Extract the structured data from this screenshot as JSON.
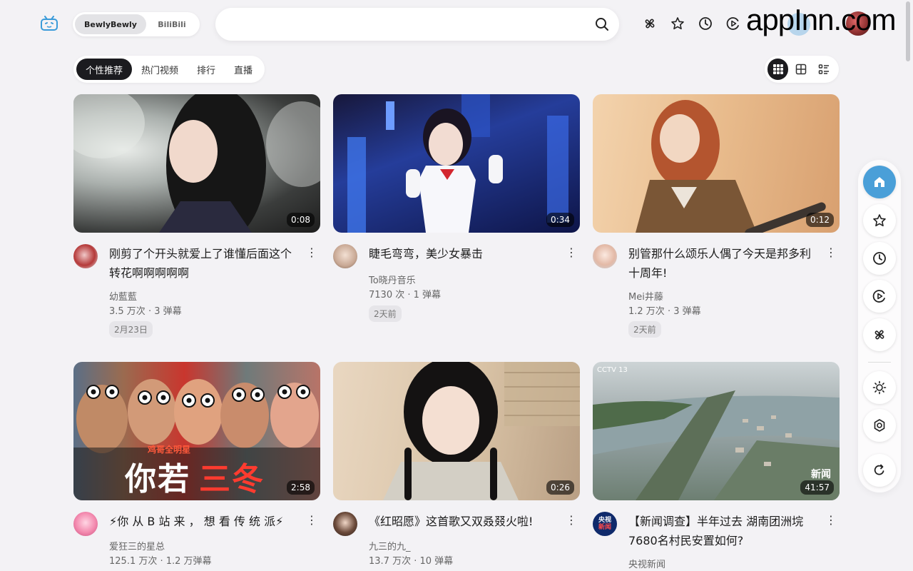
{
  "header": {
    "switch": {
      "active": "BewlyBewly",
      "other": "BiliBili"
    },
    "search": {
      "placeholder": ""
    },
    "watermark": "appInn.com"
  },
  "tabs": [
    "个性推荐",
    "热门视频",
    "排行",
    "直播"
  ],
  "videos": [
    {
      "title": "刚剪了个开头就爱上了谁懂后面这个转花啊啊啊啊啊",
      "uploader": "幼藍藍",
      "stats": "3.5 万次 · 3 弹幕",
      "date": "2月23日",
      "duration": "0:08"
    },
    {
      "title": "睫毛弯弯，美少女暴击",
      "uploader": "To晓丹音乐",
      "stats": "7130 次 · 1 弹幕",
      "date": "2天前",
      "duration": "0:34"
    },
    {
      "title": "别管那什么颂乐人偶了今天是邦多利十周年!",
      "uploader": "Mei井藤",
      "stats": "1.2 万次 · 3 弹幕",
      "date": "2天前",
      "duration": "0:12"
    },
    {
      "title": "⚡你 从 B 站 来 ， 想 看 传 统 派⚡",
      "uploader": "爱狂三的星总",
      "stats": "125.1 万次 · 1.2 万弹幕",
      "date": "",
      "duration": "2:58"
    },
    {
      "title": "《红昭愿》这首歌又双叒叕火啦!",
      "uploader": "九三的九_",
      "stats": "13.7 万次 · 10 弹幕",
      "date": "",
      "duration": "0:26"
    },
    {
      "title": "【新闻调查】半年过去 湖南团洲垸7680名村民安置如何?",
      "uploader": "央视新闻",
      "stats": "",
      "date": "",
      "duration": "41:57"
    }
  ],
  "thumb_texts": {
    "banner_small": "鸡哥全明星",
    "banner_big_a": "你若",
    "banner_big_b": "三冬",
    "news_corner": "新闻",
    "cctv_logo": "CCTV 13",
    "cctv_line1": "央视",
    "cctv_line2": "新闻"
  },
  "colors": {
    "accent": "#4a9fd8",
    "tab_active_bg": "#1b1b1f",
    "page_bg": "#f3f2f5"
  },
  "dock_icons": [
    "home-icon",
    "star-icon",
    "clock-icon",
    "play-circle-icon",
    "pinwheel-icon",
    "sun-icon",
    "settings-icon",
    "refresh-icon"
  ]
}
